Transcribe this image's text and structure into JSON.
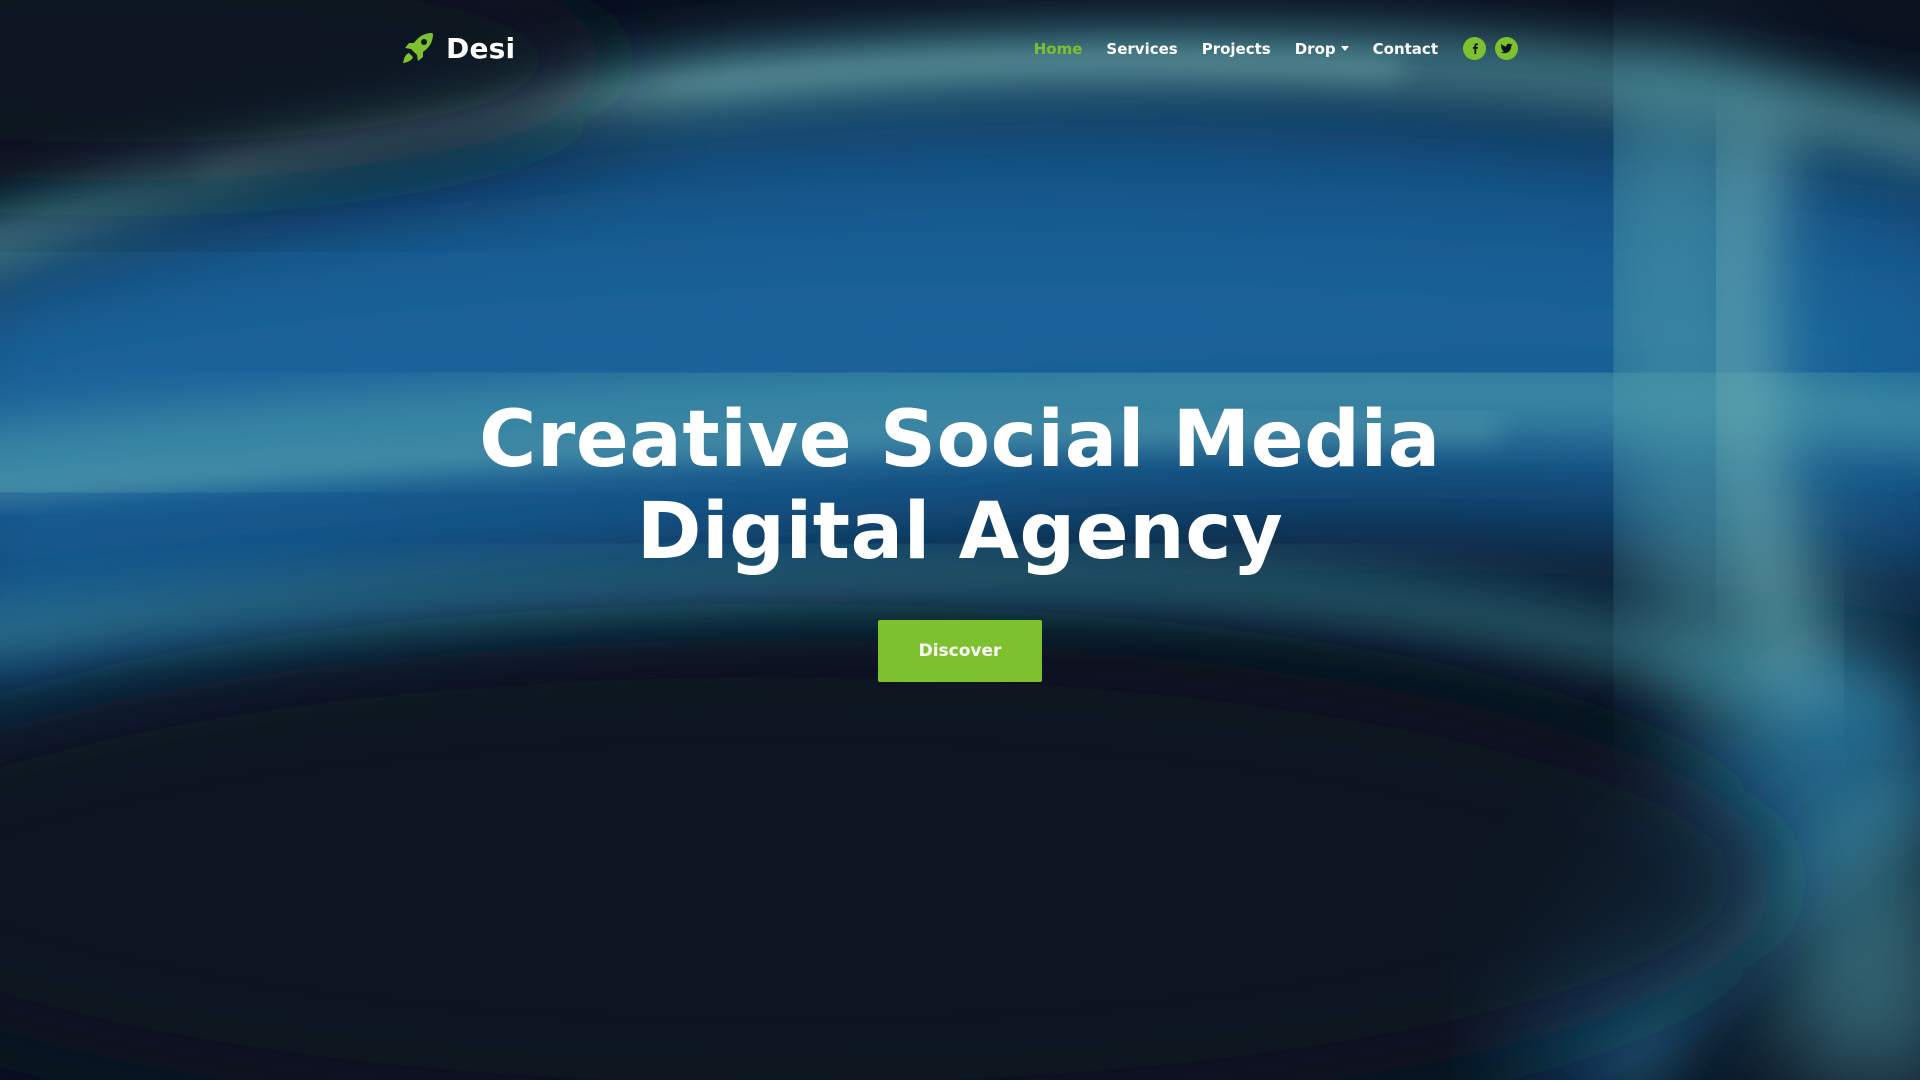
{
  "brand": {
    "name": "Desi",
    "icon": "rocket-icon"
  },
  "nav": {
    "items": [
      {
        "label": "Home",
        "active": true
      },
      {
        "label": "Services",
        "active": false
      },
      {
        "label": "Projects",
        "active": false
      },
      {
        "label": "Drop",
        "active": false,
        "dropdown": true
      },
      {
        "label": "Contact",
        "active": false
      }
    ],
    "social": [
      {
        "icon": "facebook-icon",
        "glyph": "f"
      },
      {
        "icon": "twitter-icon"
      }
    ]
  },
  "hero": {
    "title_line1": "Creative Social Media",
    "title_line2": "Digital Agency",
    "button_label": "Discover"
  },
  "colors": {
    "accent": "#7dc12e",
    "background": "#0b1220",
    "text": "#ffffff"
  }
}
